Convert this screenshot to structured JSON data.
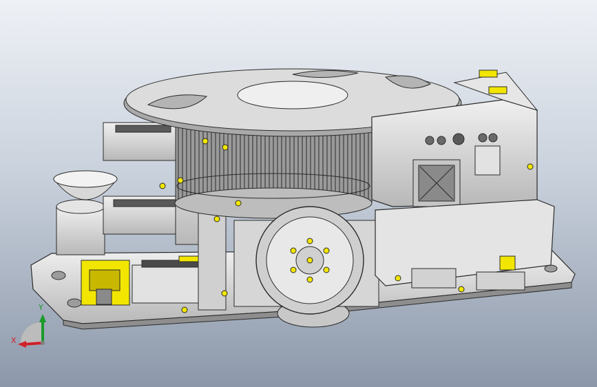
{
  "viewport": {
    "background_top": "#eef1f6",
    "background_bottom": "#8c98aa"
  },
  "model": {
    "body_color": "#d9d9d9",
    "edge_color": "#2a2a2a",
    "fastener_color": "#f2e600",
    "dark_part_color": "#5a5a5a"
  },
  "triad": {
    "x_label": "X",
    "y_label": "Y",
    "x_color": "#d0202a",
    "y_color": "#1a9b2a",
    "z_color": "#808080"
  }
}
